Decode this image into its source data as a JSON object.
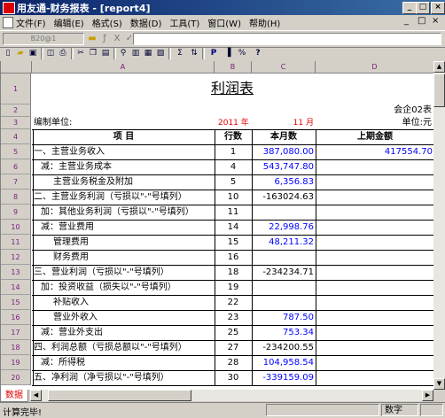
{
  "window": {
    "title": "用友通-财务报表 - [report4]",
    "controls": [
      "_",
      "□",
      "×"
    ],
    "mdi_controls": [
      "_",
      "□",
      "×"
    ]
  },
  "menu": [
    "文件(F)",
    "编辑(E)",
    "格式(S)",
    "数据(D)",
    "工具(T)",
    "窗口(W)",
    "帮助(H)"
  ],
  "formula_bar": {
    "cell_ref": "B20@1",
    "buttons": [
      "X",
      "✓"
    ],
    "value": ""
  },
  "toolbar": {
    "buttons": [
      "new",
      "open",
      "save",
      "print-preview",
      "print",
      "cut",
      "copy",
      "paste",
      "format-painter",
      "insert-column",
      "insert-row",
      "sum",
      "sort",
      "P",
      "chart",
      "percent",
      "help"
    ],
    "p_label": "P",
    "sum_label": "Σ",
    "help_label": "?"
  },
  "sheet": {
    "columns": [
      "A",
      "B",
      "C",
      "D"
    ],
    "rows": [
      "1",
      "2",
      "3",
      "4",
      "5",
      "6",
      "7",
      "8",
      "9",
      "10",
      "11",
      "12",
      "13",
      "14",
      "15",
      "16",
      "17",
      "18",
      "19",
      "20"
    ],
    "title": "利润表",
    "form_no": "会企02表",
    "unit_label": "编制单位:",
    "year": "2011 年",
    "month": "11 月",
    "currency_unit": "单位:元",
    "headers": [
      "项 目",
      "行数",
      "本月数",
      "上期金额"
    ],
    "lines": [
      {
        "item": "一、主营业务收入",
        "line": "1",
        "current": "387,080.00",
        "prior": "417554.70"
      },
      {
        "item": "减：主营业务成本",
        "line": "4",
        "current": "543,747.80",
        "prior": ""
      },
      {
        "item": "主营业务税金及附加",
        "line": "5",
        "current": "6,356.83",
        "prior": ""
      },
      {
        "item": "二、主营业务利润（亏损以\"-\"号填列）",
        "line": "10",
        "current": "-163024.63",
        "prior": ""
      },
      {
        "item": "加：其他业务利润（亏损以\"-\"号填列）",
        "line": "11",
        "current": "",
        "prior": ""
      },
      {
        "item": "减：营业费用",
        "line": "14",
        "current": "22,998.76",
        "prior": ""
      },
      {
        "item": "管理费用",
        "line": "15",
        "current": "48,211.32",
        "prior": ""
      },
      {
        "item": "财务费用",
        "line": "16",
        "current": "",
        "prior": ""
      },
      {
        "item": "三、营业利润（亏损以\"-\"号填列）",
        "line": "18",
        "current": "-234234.71",
        "prior": ""
      },
      {
        "item": "加：投资收益（损失以\"-\"号填列）",
        "line": "19",
        "current": "",
        "prior": ""
      },
      {
        "item": "补贴收入",
        "line": "22",
        "current": "",
        "prior": ""
      },
      {
        "item": "营业外收入",
        "line": "23",
        "current": "787.50",
        "prior": ""
      },
      {
        "item": "减：营业外支出",
        "line": "25",
        "current": "753.34",
        "prior": ""
      },
      {
        "item": "四、利润总额（亏损总额以\"-\"号填列）",
        "line": "27",
        "current": "-234200.55",
        "prior": ""
      },
      {
        "item": "减：所得税",
        "line": "28",
        "current": "104,958.54",
        "prior": ""
      },
      {
        "item": "五、净利润（净亏损以\"-\"号填列）",
        "line": "30",
        "current": "-339159.09",
        "prior": ""
      }
    ]
  },
  "sheet_tab": "数据",
  "status": {
    "message": "计算完毕!",
    "mode": "数字"
  },
  "colors": {
    "title_bar": "#0a246a",
    "link_blue": "#0000ff",
    "accent_red": "#e00000",
    "header_purple": "#7a1a7a"
  }
}
